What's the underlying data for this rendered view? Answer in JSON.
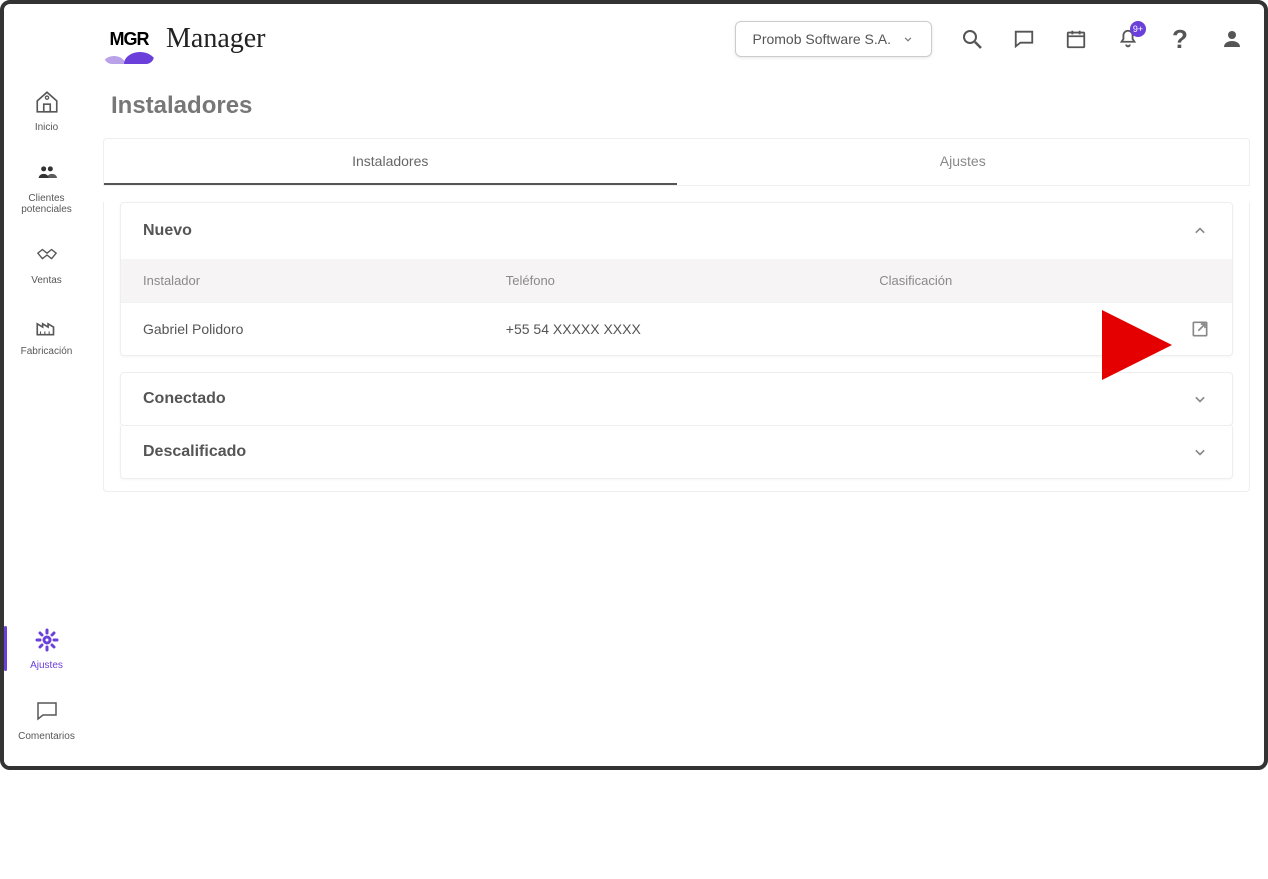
{
  "header": {
    "logo_text": "MGR",
    "app_title": "Manager",
    "company_label": "Promob Software S.A.",
    "notification_badge": "9+"
  },
  "sidebar": {
    "items": [
      {
        "label": "Inicio"
      },
      {
        "label": "Clientes potenciales"
      },
      {
        "label": "Ventas"
      },
      {
        "label": "Fabricación"
      },
      {
        "label": "Ajustes"
      },
      {
        "label": "Comentarios"
      }
    ]
  },
  "page": {
    "title": "Instaladores",
    "tabs": [
      {
        "label": "Instaladores"
      },
      {
        "label": "Ajustes"
      }
    ],
    "sections": {
      "nuevo": {
        "title": "Nuevo",
        "columns": {
          "installer": "Instalador",
          "phone": "Teléfono",
          "classification": "Clasificación"
        },
        "rows": [
          {
            "name": "Gabriel Polidoro",
            "phone": "+55 54  XXXXX XXXX",
            "classification": ""
          }
        ]
      },
      "conectado": {
        "title": "Conectado"
      },
      "descalificado": {
        "title": "Descalificado"
      }
    }
  }
}
